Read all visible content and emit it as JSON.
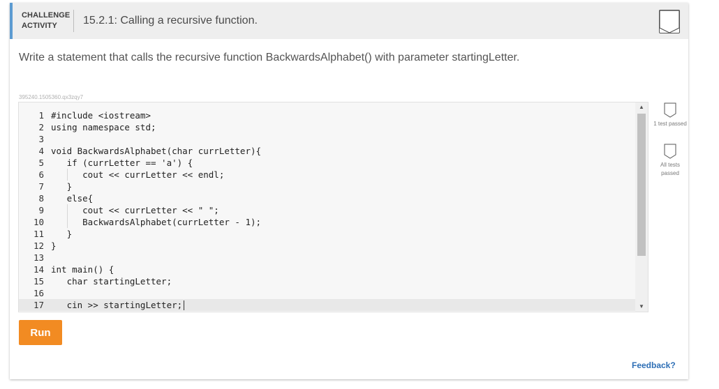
{
  "header": {
    "kind_line1": "CHALLENGE",
    "kind_line2": "ACTIVITY",
    "title": "15.2.1: Calling a recursive function."
  },
  "prompt": "Write a statement that calls the recursive function BackwardsAlphabet() with parameter startingLetter.",
  "activity_id": "395240.1505360.qx3zqy7",
  "editor": {
    "lines": [
      {
        "num": "1",
        "text": "#include <iostream>"
      },
      {
        "num": "2",
        "text": "using namespace std;"
      },
      {
        "num": "3",
        "text": ""
      },
      {
        "num": "4",
        "text": "void BackwardsAlphabet(char currLetter){"
      },
      {
        "num": "5",
        "text": "   if (currLetter == 'a') {"
      },
      {
        "num": "6",
        "text": "      cout << currLetter << endl;"
      },
      {
        "num": "7",
        "text": "   }"
      },
      {
        "num": "8",
        "text": "   else{"
      },
      {
        "num": "9",
        "text": "      cout << currLetter << \" \";"
      },
      {
        "num": "10",
        "text": "      BackwardsAlphabet(currLetter - 1);"
      },
      {
        "num": "11",
        "text": "   }"
      },
      {
        "num": "12",
        "text": "}"
      },
      {
        "num": "13",
        "text": ""
      },
      {
        "num": "14",
        "text": "int main() {"
      },
      {
        "num": "15",
        "text": "   char startingLetter;"
      },
      {
        "num": "16",
        "text": ""
      },
      {
        "num": "17",
        "text": "   cin >> startingLetter;"
      }
    ]
  },
  "side_status": {
    "one_test": "1 test passed",
    "all_tests": "All tests passed"
  },
  "run_label": "Run",
  "feedback_label": "Feedback?",
  "colors": {
    "accent": "#5c9bd1",
    "run_button": "#f28b22",
    "link": "#2d6eb5"
  },
  "icons": {
    "header_badge": "completion-badge-icon",
    "test_badge": "test-badge-icon"
  }
}
